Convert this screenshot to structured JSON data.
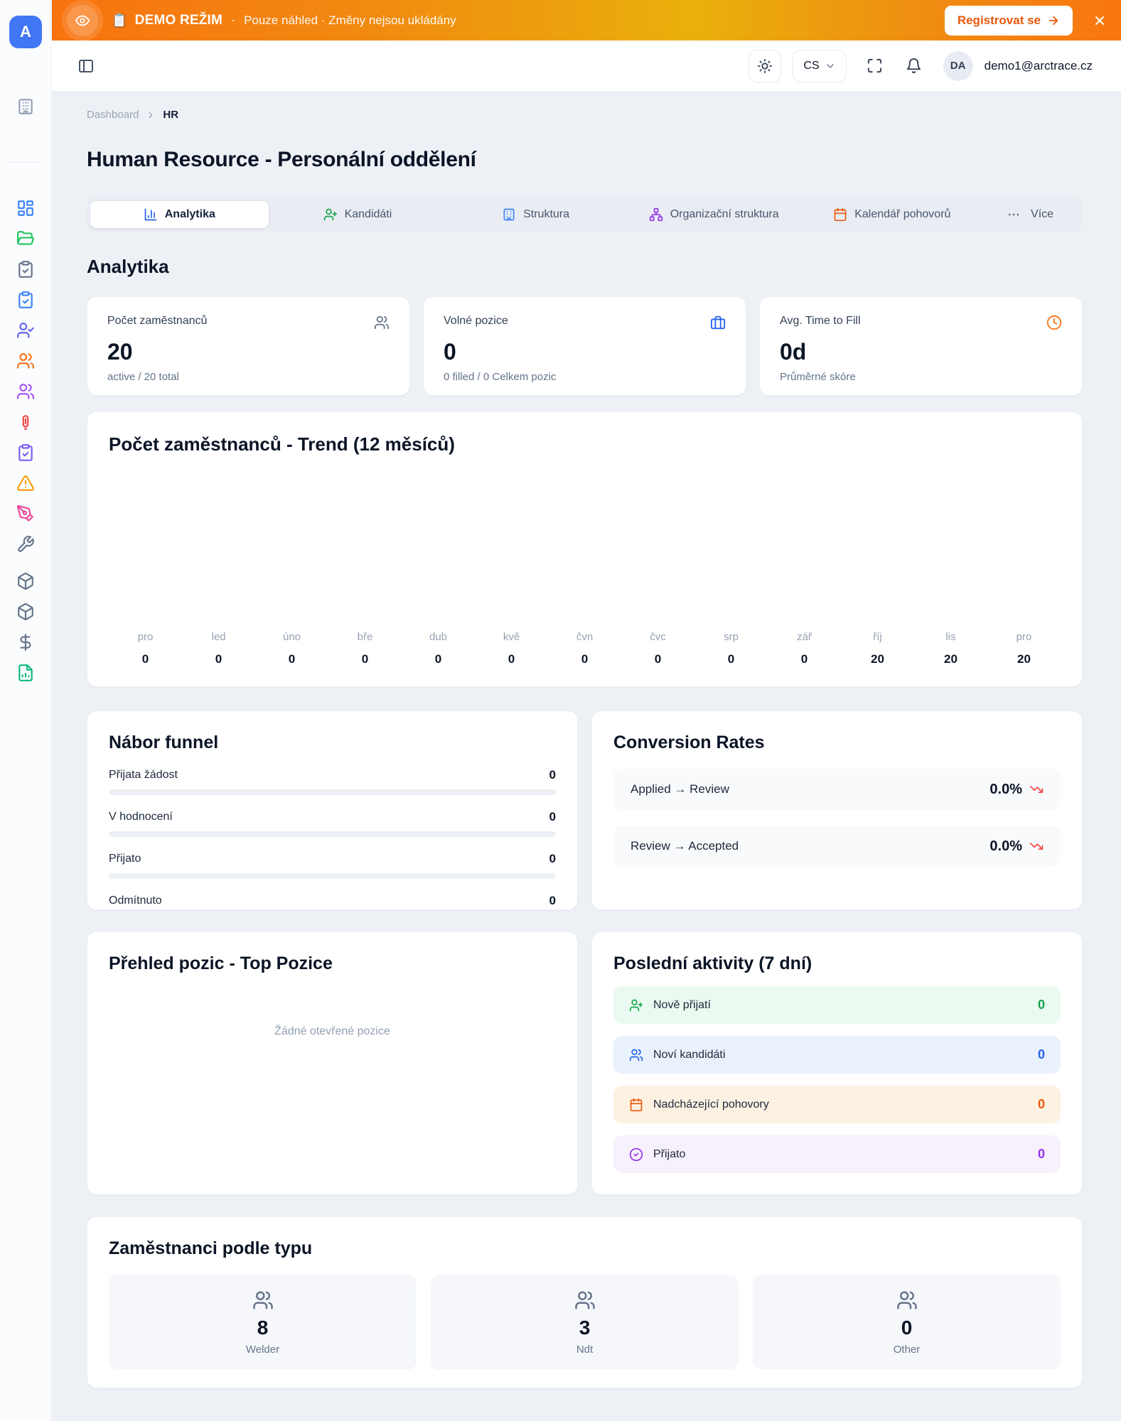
{
  "colors": {
    "accent_orange": "#f97316",
    "brand_blue": "#4176f5",
    "link_blue": "#2563eb",
    "green": "#16a34a",
    "purple": "#9333ea",
    "red_down": "#ef4444"
  },
  "banner": {
    "eye_icon": "eye-icon",
    "emoji": "📋",
    "demo_label": "DEMO REŽIM",
    "separator": "·",
    "message": "Pouze náhled · Změny nejsou ukládány",
    "register_label": "Registrovat se",
    "close_icon": "x-icon"
  },
  "header": {
    "language": "CS",
    "avatar_initials": "DA",
    "email": "demo1@arctrace.cz"
  },
  "sidebar": {
    "logo_text": "A",
    "icons": [
      "building-icon",
      "dashboard-grid-icon",
      "folder-open-icon",
      "clipboard-check-gray-icon",
      "clipboard-check-blue-icon",
      "user-check-icon",
      "users-orange-icon",
      "users-purple-icon",
      "fire-extinguisher-icon",
      "clipboard-check-purple-icon",
      "warning-triangle-icon",
      "pen-tool-icon",
      "wrench-icon",
      "package-icon",
      "package-icon",
      "dollar-icon",
      "report-chart-icon"
    ]
  },
  "breadcrumb": {
    "root": "Dashboard",
    "current": "HR"
  },
  "page": {
    "title": "Human Resource - Personální oddělení",
    "section_heading": "Analytika"
  },
  "tabs": [
    {
      "label": "Analytika",
      "icon": "bar-chart-icon"
    },
    {
      "label": "Kandidáti",
      "icon": "user-plus-icon"
    },
    {
      "label": "Struktura",
      "icon": "building-icon"
    },
    {
      "label": "Organizační struktura",
      "icon": "org-chart-icon"
    },
    {
      "label": "Kalendář pohovorů",
      "icon": "calendar-icon"
    },
    {
      "label": "Více",
      "icon": "ellipsis-icon"
    }
  ],
  "stats": [
    {
      "label": "Počet zaměstnanců",
      "value": "20",
      "sub": "active / 20 total",
      "icon": "users-icon"
    },
    {
      "label": "Volné pozice",
      "value": "0",
      "sub": "0 filled / 0 Celkem pozic",
      "icon": "briefcase-icon"
    },
    {
      "label": "Avg. Time to Fill",
      "value": "0d",
      "sub": "Průměrné skóre",
      "icon": "clock-icon"
    }
  ],
  "chart_data": {
    "type": "line",
    "title": "Počet zaměstnanců - Trend (12 měsíců)",
    "categories": [
      "pro",
      "led",
      "úno",
      "bře",
      "dub",
      "kvě",
      "čvn",
      "čvc",
      "srp",
      "zář",
      "říj",
      "lis",
      "pro"
    ],
    "values": [
      0,
      0,
      0,
      0,
      0,
      0,
      0,
      0,
      0,
      0,
      20,
      20,
      20
    ],
    "xlabel": "",
    "ylabel": "",
    "grid": false,
    "legend": false,
    "layout_hint": "plot area empty; month labels with value data-labels rendered along bottom edge"
  },
  "funnel": {
    "title": "Nábor funnel",
    "rows": [
      {
        "label": "Přijata žádost",
        "value": "0"
      },
      {
        "label": "V hodnocení",
        "value": "0"
      },
      {
        "label": "Přijato",
        "value": "0"
      },
      {
        "label": "Odmítnuto",
        "value": "0"
      }
    ]
  },
  "conversion": {
    "title": "Conversion Rates",
    "rows": [
      {
        "label": "Applied → Review",
        "value": "0.0%",
        "trend_icon": "trending-down-icon"
      },
      {
        "label": "Review → Accepted",
        "value": "0.0%",
        "trend_icon": "trending-down-icon"
      }
    ]
  },
  "positions": {
    "title": "Přehled pozic - Top Pozice",
    "empty_text": "Žádné otevřené pozice"
  },
  "activities": {
    "title": "Poslední aktivity (7 dní)",
    "rows": [
      {
        "label": "Nově přijatí",
        "value": "0",
        "icon": "user-plus-icon",
        "color": "green"
      },
      {
        "label": "Noví kandidáti",
        "value": "0",
        "icon": "users-icon",
        "color": "blue"
      },
      {
        "label": "Nadcházející pohovory",
        "value": "0",
        "icon": "calendar-icon",
        "color": "orange"
      },
      {
        "label": "Přijato",
        "value": "0",
        "icon": "check-circle-icon",
        "color": "purple"
      }
    ]
  },
  "employee_types": {
    "title": "Zaměstnanci podle typu",
    "tiles": [
      {
        "value": "8",
        "label": "Welder",
        "icon": "users-icon"
      },
      {
        "value": "3",
        "label": "Ndt",
        "icon": "users-icon"
      },
      {
        "value": "0",
        "label": "Other",
        "icon": "users-icon"
      }
    ]
  }
}
